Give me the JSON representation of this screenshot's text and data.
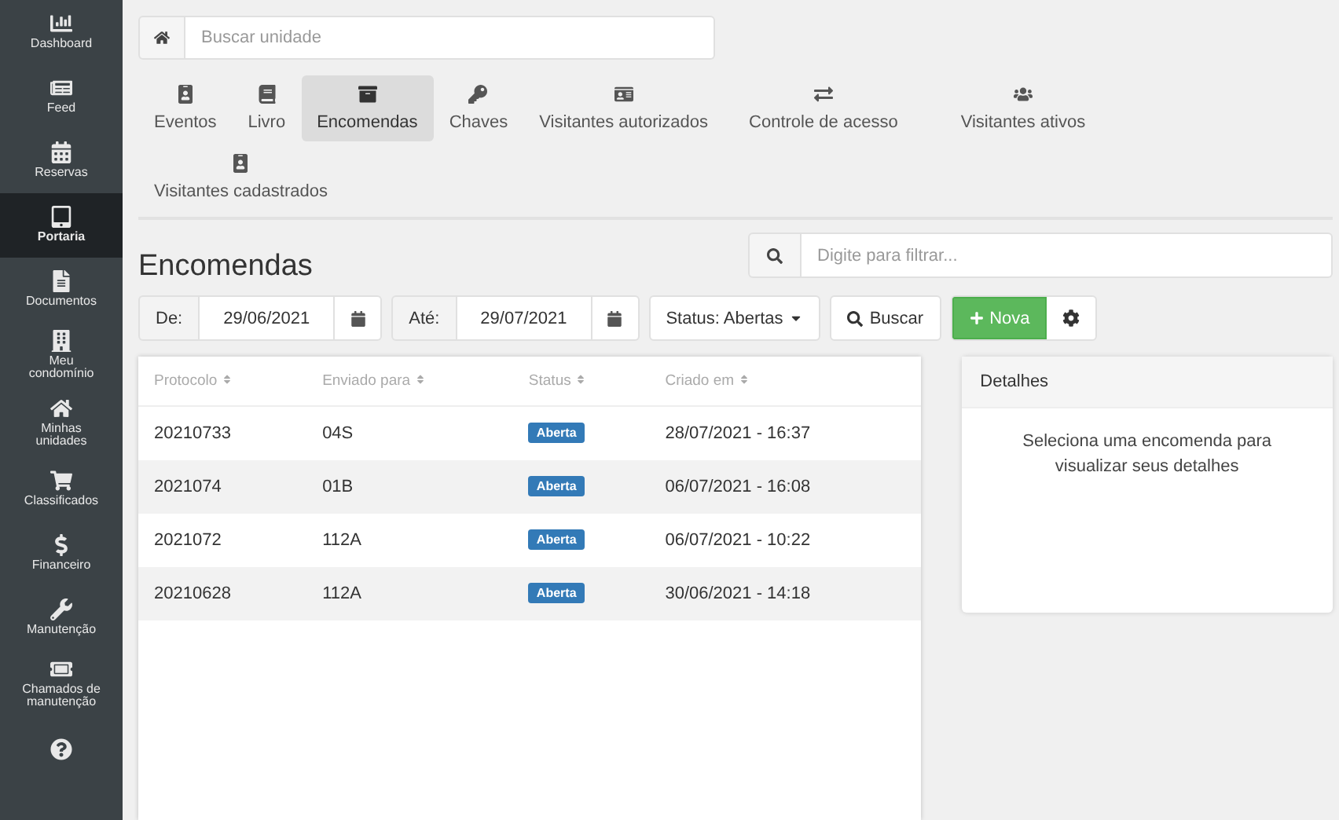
{
  "sidebar": {
    "items": [
      {
        "label": "Dashboard",
        "selected": false
      },
      {
        "label": "Feed",
        "selected": false
      },
      {
        "label": "Reservas",
        "selected": false
      },
      {
        "label": "Portaria",
        "selected": true
      },
      {
        "label": "Documentos",
        "selected": false
      },
      {
        "label": "Meu condomínio",
        "selected": false
      },
      {
        "label": "Minhas unidades",
        "selected": false
      },
      {
        "label": "Classificados",
        "selected": false
      },
      {
        "label": "Financeiro",
        "selected": false
      },
      {
        "label": "Manutenção",
        "selected": false
      },
      {
        "label": "Chamados de manutenção",
        "selected": false
      }
    ]
  },
  "unit_search": {
    "placeholder": "Buscar unidade"
  },
  "tabs": [
    {
      "label": "Eventos",
      "selected": false
    },
    {
      "label": "Livro",
      "selected": false
    },
    {
      "label": "Encomendas",
      "selected": true
    },
    {
      "label": "Chaves",
      "selected": false
    },
    {
      "label": "Visitantes autorizados",
      "selected": false
    },
    {
      "label": "Controle de acesso",
      "selected": false
    },
    {
      "label": "Visitantes ativos",
      "selected": false
    },
    {
      "label": "Visitantes cadastrados",
      "selected": false
    }
  ],
  "page_title": "Encomendas",
  "filter": {
    "placeholder": "Digite para filtrar..."
  },
  "toolbar": {
    "from_label": "De:",
    "from_value": "29/06/2021",
    "to_label": "Até:",
    "to_value": "29/07/2021",
    "status_dropdown": "Status: Abertas",
    "search_button": "Buscar",
    "new_button": "Nova"
  },
  "table": {
    "columns": [
      "Protocolo",
      "Enviado para",
      "Status",
      "Criado em"
    ],
    "rows": [
      {
        "protocol": "20210733",
        "sent_to": "04S",
        "status": "Aberta",
        "created": "28/07/2021 - 16:37"
      },
      {
        "protocol": "2021074",
        "sent_to": "01B",
        "status": "Aberta",
        "created": "06/07/2021 - 16:08"
      },
      {
        "protocol": "2021072",
        "sent_to": "112A",
        "status": "Aberta",
        "created": "06/07/2021 - 10:22"
      },
      {
        "protocol": "20210628",
        "sent_to": "112A",
        "status": "Aberta",
        "created": "30/06/2021 - 14:18"
      }
    ]
  },
  "details": {
    "title": "Detalhes",
    "message": "Seleciona uma encomenda para visualizar seus detalhes"
  }
}
